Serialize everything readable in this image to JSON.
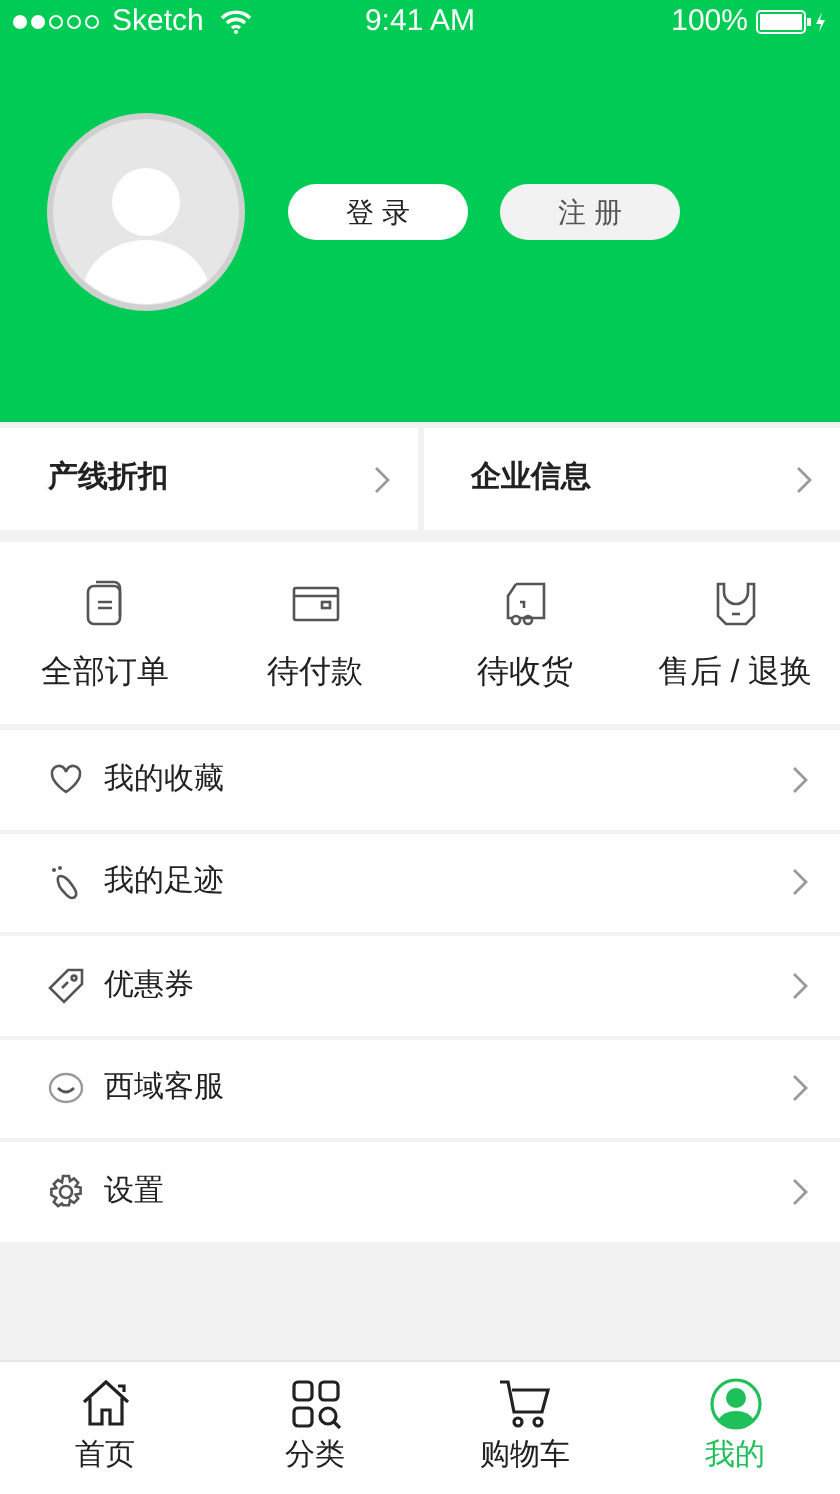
{
  "status_bar": {
    "carrier": "Sketch",
    "time": "9:41 AM",
    "battery": "100%"
  },
  "profile": {
    "buttons": [
      {
        "label": "登 录",
        "kind": "primary"
      },
      {
        "label": "注 册",
        "kind": "secondary"
      }
    ]
  },
  "shortcuts": [
    {
      "label": "产线折扣"
    },
    {
      "label": "企业信息"
    }
  ],
  "orders": [
    {
      "label": "全部订单",
      "kind": "list"
    },
    {
      "label": "待付款",
      "kind": "wallet"
    },
    {
      "label": "待收货",
      "kind": "truck"
    },
    {
      "label": "售后 / 退换",
      "kind": "bag"
    }
  ],
  "menu": [
    {
      "label": "我的收藏",
      "kind": "heart"
    },
    {
      "label": "我的足迹",
      "kind": "footprint"
    },
    {
      "label": "优惠券",
      "kind": "tag"
    },
    {
      "label": "西域客服",
      "kind": "chat"
    },
    {
      "label": "设置",
      "kind": "gear"
    }
  ],
  "tab_bar": [
    {
      "label": "首页",
      "kind": "home",
      "selected": false
    },
    {
      "label": "分类",
      "kind": "grid",
      "selected": false
    },
    {
      "label": "购物车",
      "kind": "cart",
      "selected": false
    },
    {
      "label": "我的",
      "kind": "user",
      "selected": true
    }
  ]
}
